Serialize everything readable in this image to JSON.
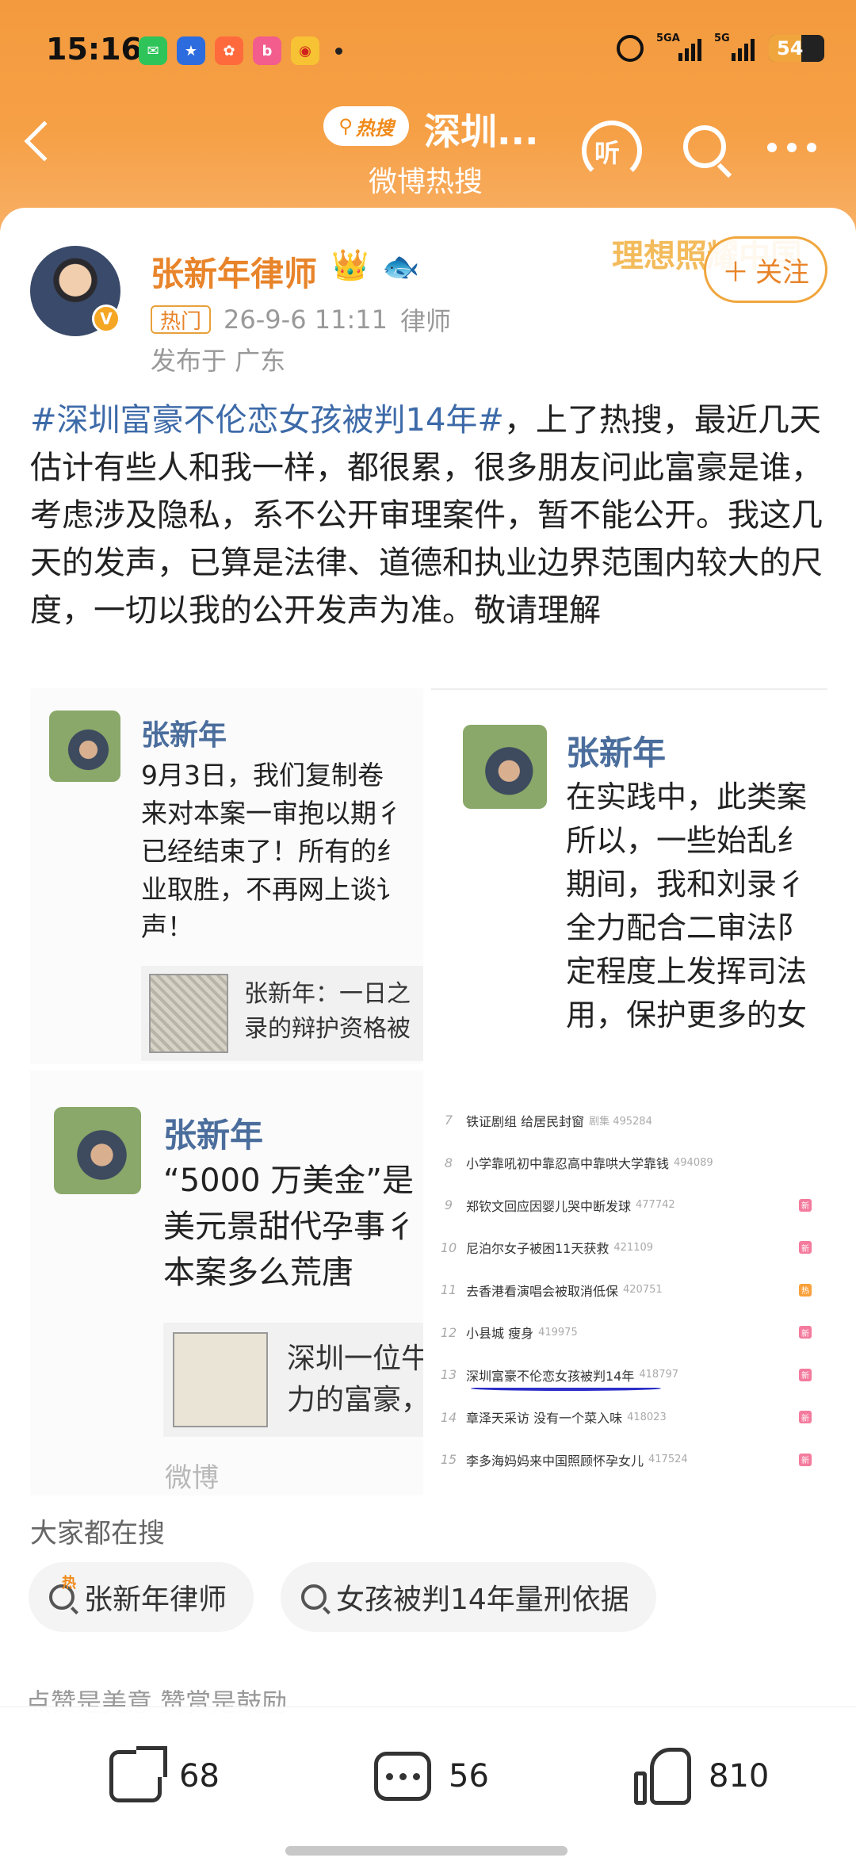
{
  "status": {
    "time": "15:16",
    "battery": "54",
    "sig1": "5GA",
    "sig2": "5G"
  },
  "header": {
    "badge": "热搜",
    "title": "深圳...",
    "subtitle": "微博热搜",
    "listen_label": "听"
  },
  "post": {
    "author": "张新年律师",
    "hot_tag": "热门",
    "time": "26-9-6 11:11",
    "role": "律师",
    "location": "发布于 广东",
    "watermark": "理想照耀中国",
    "follow_label": "关注",
    "topic": "#深圳富豪不伦恋女孩被判14年#",
    "text": "，上了热搜，最近几天估计有些人和我一样，都很累，很多朋友问此富豪是谁，考虑涉及隐私，系不公开审理案件，暂不能公开。我这几天的发声，已算是法律、道德和执业边界范围内较大的尺度，一切以我的公开发声为准。敬请理解"
  },
  "shot1": {
    "name": "张新年",
    "text": "9月3日，我们复制卷\n来对本案一审抱以期彳\n已经结束了！所有的纟\n业取胜，不再网上谈讠\n声！",
    "quote": "张新年：一日之\n录的辩护资格被"
  },
  "shot2": {
    "name": "张新年",
    "text": "在实践中，此类案\n所以，一些始乱纟\n期间，我和刘录彳\n全力配合二审法阝\n定程度上发挥司法\n用，保护更多的女"
  },
  "shot3": {
    "name": "张新年",
    "text": "“5000 万美金”是\n美元景甜代孕事彳\n本案多么荒唐",
    "quote": "深圳一位牛\n力的富豪，",
    "logo": "微博"
  },
  "ranking": [
    {
      "n": "7",
      "t": "铁证剧组 给居民封窗",
      "c": "剧集 495284",
      "b": ""
    },
    {
      "n": "8",
      "t": "小学靠吼初中靠忍高中靠哄大学靠钱",
      "c": "494089",
      "b": ""
    },
    {
      "n": "9",
      "t": "郑钦文回应因婴儿哭中断发球",
      "c": "477742",
      "b": "新"
    },
    {
      "n": "10",
      "t": "尼泊尔女子被困11天获救",
      "c": "421109",
      "b": "新"
    },
    {
      "n": "11",
      "t": "去香港看演唱会被取消低保",
      "c": "420751",
      "b": "热"
    },
    {
      "n": "12",
      "t": "小县城 瘦身",
      "c": "419975",
      "b": "新"
    },
    {
      "n": "13",
      "t": "深圳富豪不伦恋女孩被判14年",
      "c": "418797",
      "b": "新"
    },
    {
      "n": "14",
      "t": "章泽天采访 没有一个菜入味",
      "c": "418023",
      "b": "新"
    },
    {
      "n": "15",
      "t": "李多海妈妈来中国照顾怀孕女儿",
      "c": "417524",
      "b": "新"
    }
  ],
  "related": {
    "label": "大家都在搜",
    "chips": [
      {
        "text": "张新年律师",
        "hot": "热"
      },
      {
        "text": "女孩被判14年量刑依据"
      }
    ]
  },
  "footer": {
    "tip": "点赞是美意  赞赏是鼓励",
    "share": "68",
    "comments": "56",
    "likes": "810"
  },
  "colors": {
    "accent": "#f39a3e",
    "topic": "#3d6aa8",
    "name": "#e8842a"
  }
}
